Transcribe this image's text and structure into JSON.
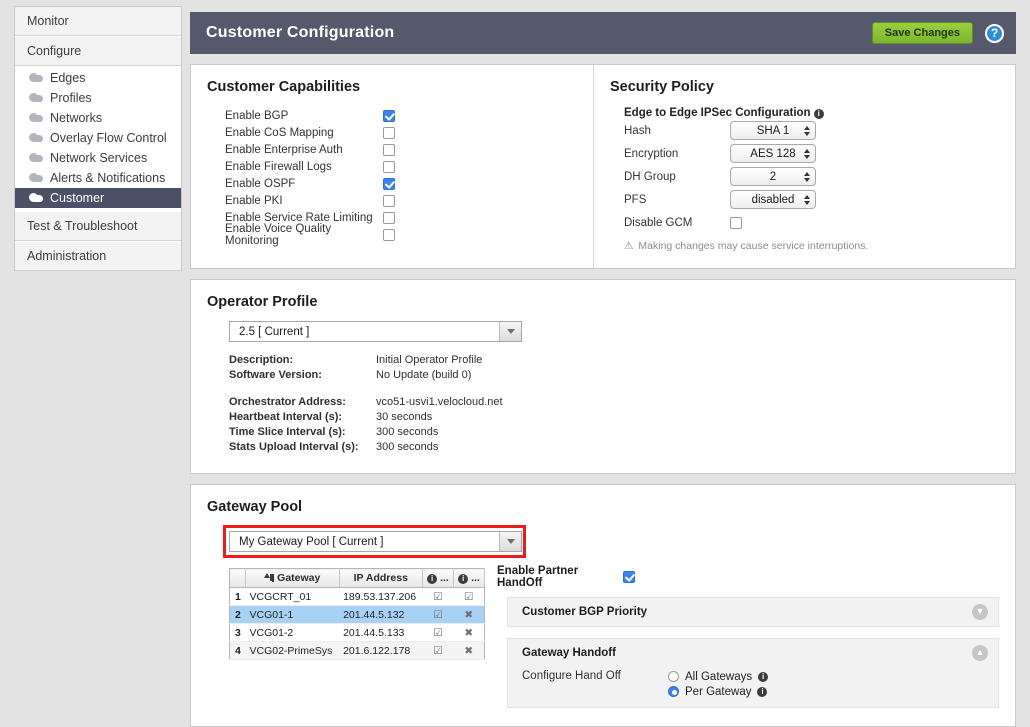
{
  "sidebar": {
    "sections": [
      {
        "label": "Monitor",
        "type": "section"
      },
      {
        "label": "Configure",
        "type": "section"
      }
    ],
    "configure_items": [
      {
        "label": "Edges",
        "active": false
      },
      {
        "label": "Profiles",
        "active": false
      },
      {
        "label": "Networks",
        "active": false
      },
      {
        "label": "Overlay Flow Control",
        "active": false
      },
      {
        "label": "Network Services",
        "active": false
      },
      {
        "label": "Alerts & Notifications",
        "active": false
      },
      {
        "label": "Customer",
        "active": true
      }
    ],
    "bottom_sections": [
      {
        "label": "Test & Troubleshoot"
      },
      {
        "label": "Administration"
      }
    ],
    "icon": "cloud-icon"
  },
  "header": {
    "title": "Customer Configuration",
    "save_label": "Save Changes",
    "help_label": "?",
    "bg_color": "#56596b",
    "save_color": "#8cc63f",
    "help_color": "#2b8ed6"
  },
  "capabilities": {
    "title": "Customer Capabilities",
    "items": [
      {
        "label": "Enable BGP",
        "checked": true
      },
      {
        "label": "Enable CoS Mapping",
        "checked": false
      },
      {
        "label": "Enable Enterprise Auth",
        "checked": false
      },
      {
        "label": "Enable Firewall Logs",
        "checked": false
      },
      {
        "label": "Enable OSPF",
        "checked": true
      },
      {
        "label": "Enable PKI",
        "checked": false
      },
      {
        "label": "Enable Service Rate Limiting",
        "checked": false
      },
      {
        "label": "Enable Voice Quality Monitoring",
        "checked": false
      }
    ]
  },
  "security": {
    "title": "Security Policy",
    "subtitle": "Edge to Edge IPSec Configuration",
    "fields": [
      {
        "label": "Hash",
        "value": "SHA 1"
      },
      {
        "label": "Encryption",
        "value": "AES 128"
      },
      {
        "label": "DH Group",
        "value": "2"
      },
      {
        "label": "PFS",
        "value": "disabled"
      }
    ],
    "disable_gcm": {
      "label": "Disable GCM",
      "checked": false
    },
    "warning": "Making changes may cause service interruptions."
  },
  "operator_profile": {
    "title": "Operator Profile",
    "selected": "2.5   [ Current ]",
    "details": [
      {
        "key": "Description:",
        "value": "Initial Operator Profile"
      },
      {
        "key": "Software Version:",
        "value": "No Update (build 0)"
      }
    ],
    "details2": [
      {
        "key": "Orchestrator Address:",
        "value": "vco51-usvi1.velocloud.net"
      },
      {
        "key": "Heartbeat Interval (s):",
        "value": "30 seconds"
      },
      {
        "key": "Time Slice Interval (s):",
        "value": "300 seconds"
      },
      {
        "key": "Stats Upload Interval (s):",
        "value": "300 seconds"
      }
    ]
  },
  "gateway_pool": {
    "title": "Gateway Pool",
    "selected": "My Gateway Pool   [ Current ]",
    "highlight_color": "#ee1b1b",
    "table": {
      "columns": [
        "",
        "Gateway",
        "IP Address",
        "",
        ""
      ],
      "sort_column": "Gateway",
      "col_icon_1": "info-icon",
      "col_icon_2": "info-icon",
      "col_ellipsis": "...",
      "rows": [
        {
          "num": "1",
          "gateway": "VCGCRT_01",
          "ip": "189.53.137.206",
          "c1": "☑",
          "c2": "☑",
          "selected": false
        },
        {
          "num": "2",
          "gateway": "VCG01-1",
          "ip": "201.44.5.132",
          "c1": "☑",
          "c2": "✖",
          "selected": true
        },
        {
          "num": "3",
          "gateway": "VCG01-2",
          "ip": "201.44.5.133",
          "c1": "☑",
          "c2": "✖",
          "selected": false
        },
        {
          "num": "4",
          "gateway": "VCG02-PrimeSys",
          "ip": "201.6.122.178",
          "c1": "☑",
          "c2": "✖",
          "selected": false
        }
      ]
    },
    "partner_handoff": {
      "label": "Enable Partner HandOff",
      "checked": true
    },
    "bgp_priority": {
      "label": "Customer BGP Priority",
      "collapsed": true,
      "chevron": "chevron-double-down-icon"
    },
    "gateway_handoff": {
      "label": "Gateway Handoff",
      "collapsed": false,
      "chevron": "chevron-double-up-icon",
      "config_label": "Configure Hand Off",
      "options": [
        {
          "label": "All Gateways",
          "selected": false
        },
        {
          "label": "Per Gateway",
          "selected": true
        }
      ]
    }
  }
}
